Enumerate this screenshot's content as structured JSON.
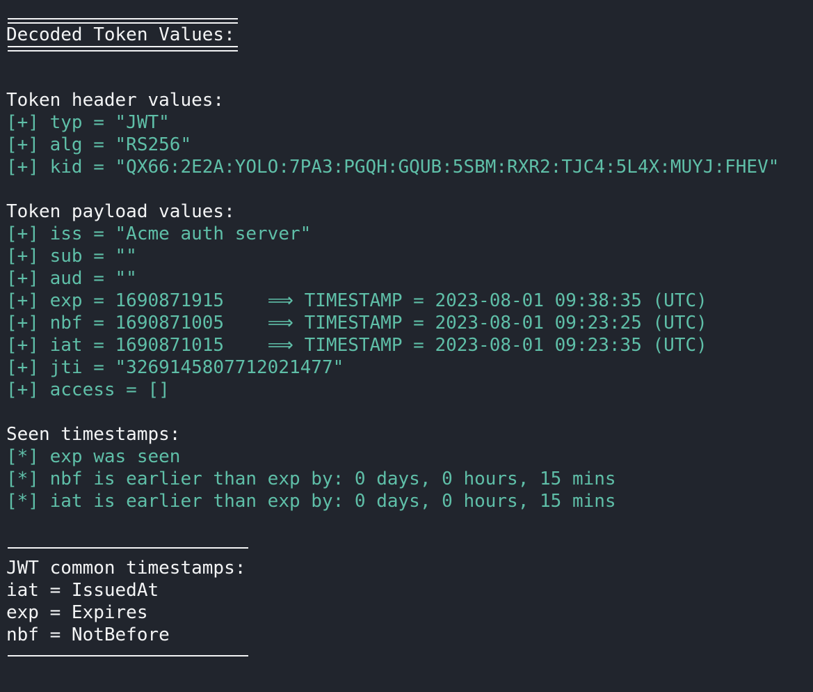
{
  "title": "Decoded Token Values:",
  "header_section": {
    "heading": "Token header values:",
    "lines": [
      "[+] typ = \"JWT\"",
      "[+] alg = \"RS256\"",
      "[+] kid = \"QX66:2E2A:YOLO:7PA3:PGQH:GQUB:5SBM:RXR2:TJC4:5L4X:MUYJ:FHEV\""
    ]
  },
  "payload_section": {
    "heading": "Token payload values:",
    "lines": [
      "[+] iss = \"Acme auth server\"",
      "[+] sub = \"\"",
      "[+] aud = \"\"",
      "[+] exp = 1690871915    ⟹ TIMESTAMP = 2023-08-01 09:38:35 (UTC)",
      "[+] nbf = 1690871005    ⟹ TIMESTAMP = 2023-08-01 09:23:25 (UTC)",
      "[+] iat = 1690871015    ⟹ TIMESTAMP = 2023-08-01 09:23:35 (UTC)",
      "[+] jti = \"3269145807712021477\"",
      "[+] access = []"
    ]
  },
  "timestamps_section": {
    "heading": "Seen timestamps:",
    "lines": [
      "[*] exp was seen",
      "[*] nbf is earlier than exp by: 0 days, 0 hours, 15 mins",
      "[*] iat is earlier than exp by: 0 days, 0 hours, 15 mins"
    ]
  },
  "legend_section": {
    "heading": "JWT common timestamps:",
    "lines": [
      "iat = IssuedAt",
      "exp = Expires",
      "nbf = NotBefore"
    ]
  },
  "colors": {
    "background": "#21252d",
    "text": "#f3f4f5",
    "accent": "#5fbfa8"
  }
}
